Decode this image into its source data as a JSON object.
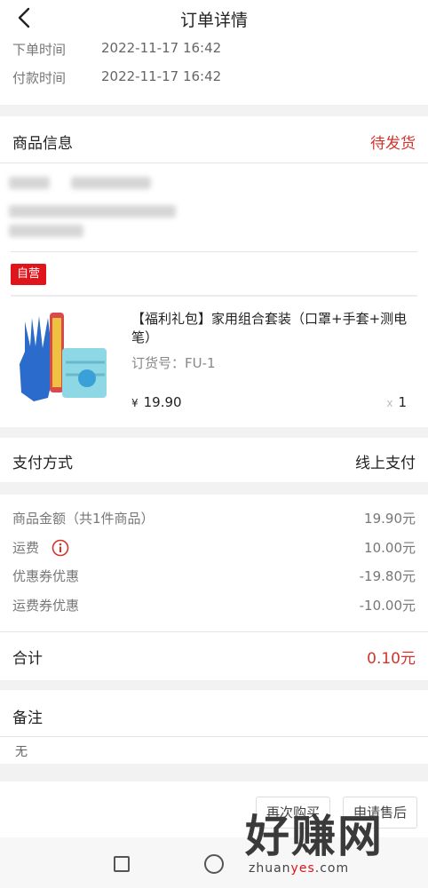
{
  "header": {
    "title": "订单详情"
  },
  "times": [
    {
      "label": "下单时间",
      "value": "2022-11-17 16:42"
    },
    {
      "label": "付款时间",
      "value": "2022-11-17 16:42"
    }
  ],
  "goods": {
    "section_title": "商品信息",
    "status": "待发货",
    "badge": "自营",
    "product": {
      "name": "【福利礼包】家用组合套装（口罩+手套+测电笔）",
      "sku": "订货号：FU-1",
      "currency": "¥",
      "price": "19.90",
      "qty_prefix": "x",
      "qty": "1"
    }
  },
  "payment": {
    "label": "支付方式",
    "value": "线上支付"
  },
  "fees": [
    {
      "label": "商品金额（共1件商品）",
      "value": "19.90元"
    },
    {
      "label": "运费",
      "value": "10.00元",
      "icon": "info-icon"
    },
    {
      "label": "优惠券优惠",
      "value": "-19.80元"
    },
    {
      "label": "运费券优惠",
      "value": "-10.00元"
    }
  ],
  "total": {
    "label": "合计",
    "value": "0.10元"
  },
  "remark": {
    "label": "备注",
    "value": "无"
  },
  "actions": {
    "rebuy": "再次购买",
    "after_sale": "申请售后"
  },
  "watermark": {
    "cn": "好赚网",
    "url_a": "zhuan",
    "url_b": "yes",
    "url_c": ".com"
  },
  "colors": {
    "accent": "#d2342c",
    "badge": "#e0151b",
    "background": "#f2f2f2"
  }
}
